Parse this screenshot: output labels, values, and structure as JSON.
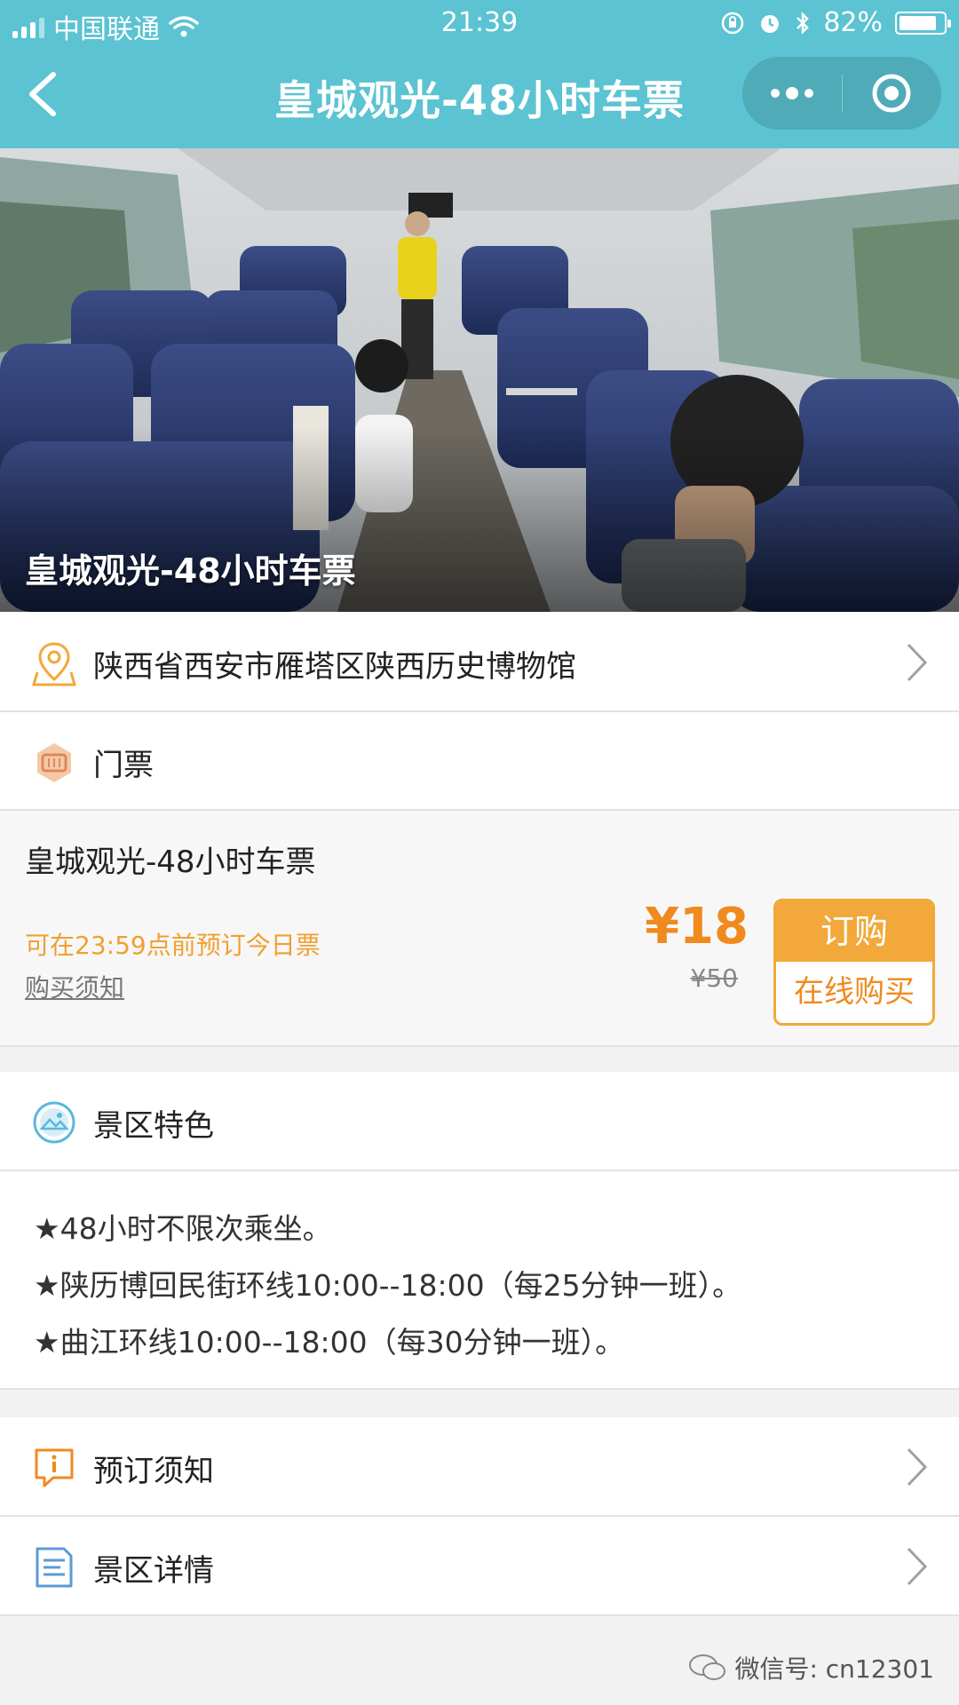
{
  "status_bar": {
    "carrier": "中国联通",
    "time": "21:39",
    "battery": "82%",
    "battery_level": 0.82
  },
  "nav": {
    "title": "皇城观光-48小时车票"
  },
  "banner": {
    "caption": "皇城观光-48小时车票"
  },
  "location": {
    "text": "陕西省西安市雁塔区陕西历史博物馆"
  },
  "ticket_section": {
    "title": "门票"
  },
  "ticket": {
    "name": "皇城观光-48小时车票",
    "deadline": "可在23:59点前预订今日票",
    "notice_link": "购买须知",
    "price": "¥18",
    "original_price": "¥50",
    "buy_label": "订购",
    "buy_sub_label": "在线购买"
  },
  "features_section": {
    "title": "景区特色",
    "items": [
      "★48小时不限次乘坐。",
      "★陕历博回民街环线10:00--18:00（每25分钟一班）。",
      "★曲江环线10:00--18:00（每30分钟一班）。"
    ]
  },
  "booking_notice": {
    "label": "预订须知"
  },
  "scenic_details": {
    "label": "景区详情"
  },
  "watermark": {
    "text": "微信号: cn12301"
  },
  "colors": {
    "header": "#5bc3d2",
    "accent_orange": "#f2a83a",
    "price_orange": "#f08a1e"
  }
}
